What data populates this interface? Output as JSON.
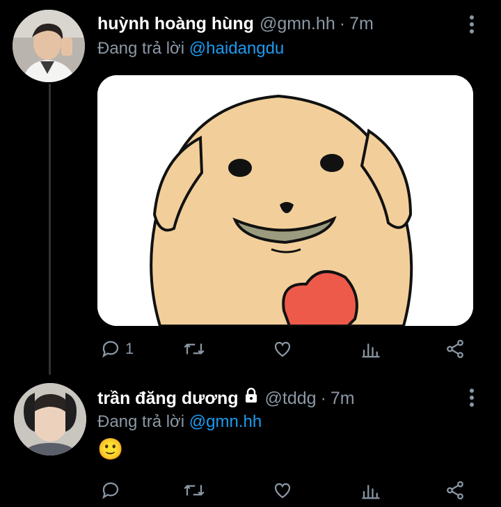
{
  "tweets": [
    {
      "display_name": "huỳnh hoàng hùng",
      "handle": "@gmn.hh",
      "separator": "·",
      "time": "7m",
      "reply_prefix": "Đang trả lời",
      "reply_to": "@haidangdu",
      "reply_count": "1",
      "icons": [
        "reply-icon",
        "retweet-icon",
        "like-icon",
        "analytics-icon",
        "share-icon"
      ]
    },
    {
      "display_name": "trần đăng dương",
      "handle": "@tddg",
      "separator": "·",
      "time": "7m",
      "reply_prefix": "Đang trả lời",
      "reply_to": "@gmn.hh",
      "text": "🙂",
      "protected": true,
      "icons": [
        "reply-icon",
        "retweet-icon",
        "like-icon",
        "analytics-icon",
        "share-icon"
      ]
    }
  ],
  "colors": {
    "background": "#000000",
    "secondary_text": "#8b98a5",
    "link": "#1d9bf0",
    "thread_line": "#2f3336"
  }
}
